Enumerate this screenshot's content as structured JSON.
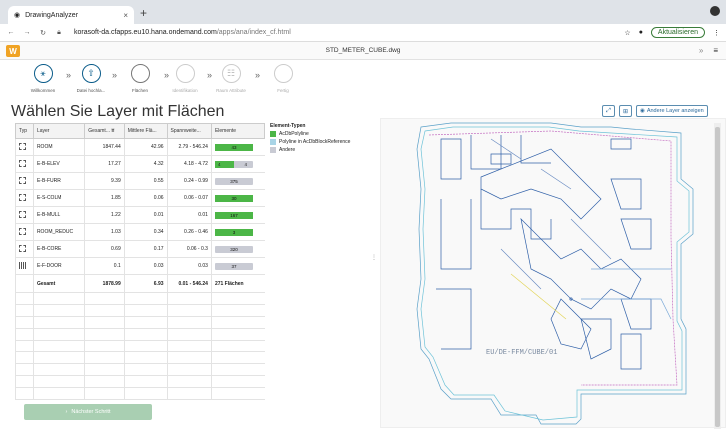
{
  "browser": {
    "tab_title": "DrawingAnalyzer",
    "tab_close": "×",
    "new_tab": "+",
    "url_host": "korasoft-da.cfapps.eu10.hana.ondemand.com",
    "url_path": "/apps/ana/index_cf.html",
    "update_label": "Aktualisieren"
  },
  "app": {
    "logo": "W",
    "file_title": "STD_METER_CUBE.dwg"
  },
  "wizard": {
    "steps": [
      {
        "label": "Willkommen",
        "state": "done"
      },
      {
        "label": "Datei hochla...",
        "state": "done"
      },
      {
        "label": "Flächen",
        "state": "current"
      },
      {
        "label": "Identifikation",
        "state": "disabled"
      },
      {
        "label": "Raum Attribute",
        "state": "disabled"
      },
      {
        "label": "Fertig",
        "state": "disabled"
      }
    ]
  },
  "page": {
    "title": "Wählen Sie Layer mit Flächen",
    "next_button": "Nächster Schritt"
  },
  "table": {
    "headers": [
      "Typ",
      "Layer",
      "Gesamt...",
      "Mittlere Flä...",
      "Spannweite...",
      "Elemente"
    ],
    "rows": [
      {
        "type": "polyline",
        "layer": "ROOM",
        "total": "1847.44",
        "mean": "42.96",
        "range": "2.79 - 546.24",
        "el_a": "43",
        "el_b": "",
        "frac": 1.0
      },
      {
        "type": "polyline",
        "layer": "E-B-ELEV",
        "total": "17.27",
        "mean": "4.32",
        "range": "4.18 - 4.72",
        "el_a": "4",
        "el_b": "4",
        "frac": 0.5
      },
      {
        "type": "polyline",
        "layer": "E-B-FURR",
        "total": "9.39",
        "mean": "0.55",
        "range": "0.24 - 0.99",
        "el_a": "375",
        "el_b": "",
        "frac": 0.0
      },
      {
        "type": "polyline",
        "layer": "E-S-COLM",
        "total": "1.85",
        "mean": "0.06",
        "range": "0.06 - 0.07",
        "el_a": "30",
        "el_b": "",
        "frac": 1.0
      },
      {
        "type": "polyline",
        "layer": "E-B-MULL",
        "total": "1.22",
        "mean": "0.01",
        "range": "0.01",
        "el_a": "167",
        "el_b": "",
        "frac": 1.0
      },
      {
        "type": "polyline",
        "layer": "ROOM_REDUC",
        "total": "1.03",
        "mean": "0.34",
        "range": "0.26 - 0.46",
        "el_a": "3",
        "el_b": "",
        "frac": 1.0
      },
      {
        "type": "polyline",
        "layer": "E-B-CORE",
        "total": "0.69",
        "mean": "0.17",
        "range": "0.06 - 0.3",
        "el_a": "320",
        "el_b": "",
        "frac": 0.0
      },
      {
        "type": "door",
        "layer": "E-F-DOOR",
        "total": "0.1",
        "mean": "0.03",
        "range": "0.03",
        "el_a": "37",
        "el_b": "",
        "frac": 0.0
      }
    ],
    "total": {
      "label": "Gesamt",
      "total": "1878.99",
      "mean": "6.93",
      "range": "0.01 - 546.24",
      "elements": "271 Flächen"
    }
  },
  "legend": {
    "title": "Element-Typen",
    "items": [
      {
        "label": "AcDbPolyline",
        "color": "#4cb647"
      },
      {
        "label": "Polyline in AcDbBlockReference",
        "color": "#a8d4e6"
      },
      {
        "label": "Andere",
        "color": "#c9cbd4"
      }
    ]
  },
  "plan": {
    "show_layers_label": "Andere Layer anzeigen",
    "watermark": "EU/DE-FFM/CUBE/01"
  },
  "colors": {
    "accent": "#0a5c8a",
    "green": "#4cb647",
    "logo": "#f0a324"
  }
}
